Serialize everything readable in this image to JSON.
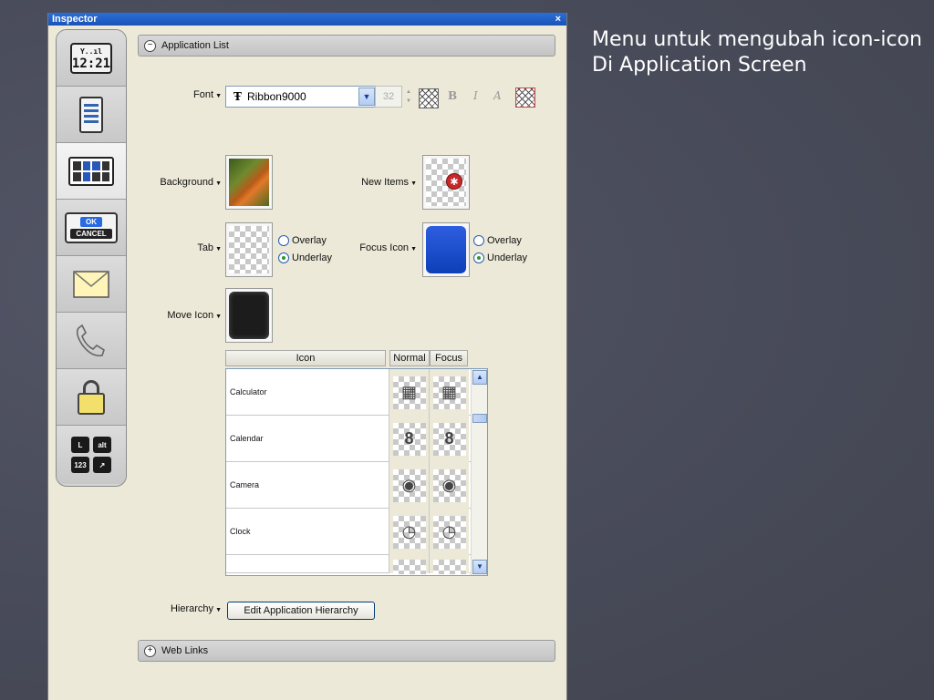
{
  "caption": {
    "line1": "Menu untuk mengubah icon-icon",
    "line2": "Di Application Screen"
  },
  "window": {
    "title": "Inspector",
    "close_glyph": "×"
  },
  "sidebar": {
    "clock_text": "12:21",
    "clock_signal": "Y..ıl",
    "ok_label": "OK",
    "cancel_label": "CANCEL",
    "keys": [
      "L",
      "alt",
      "123",
      "↗"
    ]
  },
  "section": {
    "title": "Application List",
    "collapse_glyph": "−"
  },
  "font_row": {
    "label": "Font",
    "value": "Ribbon9000",
    "size": "32",
    "bold": "B",
    "italic": "I",
    "style_glyph": "A"
  },
  "background": {
    "label": "Background"
  },
  "new_items": {
    "label": "New Items",
    "badge": "✱"
  },
  "tab": {
    "label": "Tab",
    "options": [
      "Overlay",
      "Underlay"
    ]
  },
  "focus_icon": {
    "label": "Focus Icon",
    "options": [
      "Overlay",
      "Underlay"
    ]
  },
  "move_icon": {
    "label": "Move Icon"
  },
  "table": {
    "headers": [
      "Icon",
      "Normal",
      "Focus"
    ],
    "rows": [
      {
        "name": "Calculator",
        "icon": "calculator-icon",
        "glyph": "▦"
      },
      {
        "name": "Calendar",
        "icon": "calendar-icon",
        "glyph": "8"
      },
      {
        "name": "Camera",
        "icon": "camera-icon",
        "glyph": "◉"
      },
      {
        "name": "Clock",
        "icon": "clock-icon",
        "glyph": "◷"
      }
    ]
  },
  "hierarchy": {
    "label": "Hierarchy",
    "button": "Edit Application Hierarchy"
  },
  "web_links": {
    "title": "Web Links",
    "expand_glyph": "+"
  },
  "colors": {
    "title_bar": "#1a52b8",
    "panel": "#ece9d8",
    "slide_bg": "#4a4d5c",
    "focus_blue": "#0d3fb8"
  }
}
